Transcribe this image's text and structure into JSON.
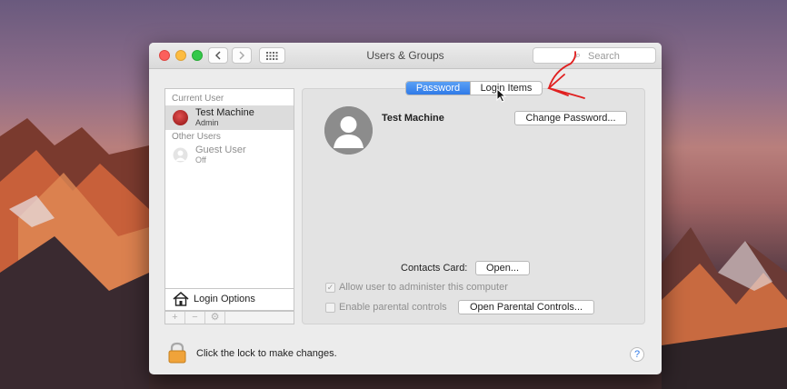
{
  "window": {
    "title": "Users & Groups"
  },
  "toolbar": {
    "back_icon": "chevron-left-icon",
    "forward_icon": "chevron-right-icon",
    "grid_icon": "grid-icon"
  },
  "search": {
    "placeholder": "Search"
  },
  "sidebar": {
    "current_user_header": "Current User",
    "current_user": {
      "name": "Test Machine",
      "role": "Admin"
    },
    "other_users_header": "Other Users",
    "other_users": [
      {
        "name": "Guest User",
        "status": "Off"
      }
    ],
    "login_options_label": "Login Options",
    "add_label": "+",
    "remove_label": "−",
    "gear_label": "⚙"
  },
  "tabs": {
    "password": "Password",
    "login_items": "Login Items",
    "active": "password"
  },
  "account": {
    "full_name": "Test Machine",
    "change_password_label": "Change Password..."
  },
  "contacts": {
    "label": "Contacts Card:",
    "open_label": "Open..."
  },
  "options": {
    "allow_admin_label": "Allow user to administer this computer",
    "allow_admin_checked": true,
    "parental_label": "Enable parental controls",
    "parental_checked": false,
    "open_parental_label": "Open Parental Controls..."
  },
  "footer": {
    "lock_text": "Click the lock to make changes.",
    "help_label": "?"
  },
  "colors": {
    "accent": "#2f7ae8",
    "annotation": "#e02020"
  }
}
